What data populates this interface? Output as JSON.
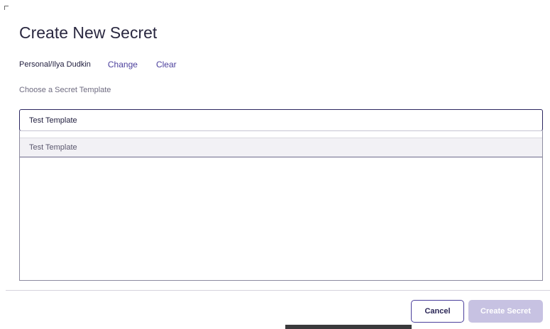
{
  "dialog": {
    "title": "Create New Secret"
  },
  "folder": {
    "path": "Personal/Ilya Dudkin",
    "change_label": "Change",
    "clear_label": "Clear"
  },
  "template": {
    "label": "Choose a Secret Template",
    "input_value": "Test Template",
    "options": [
      "Test Template"
    ]
  },
  "footer": {
    "cancel_label": "Cancel",
    "create_label": "Create Secret"
  },
  "colors": {
    "accent": "#4b3f9c",
    "input_border": "#2b2660",
    "disabled_button": "#c7c2e2"
  }
}
